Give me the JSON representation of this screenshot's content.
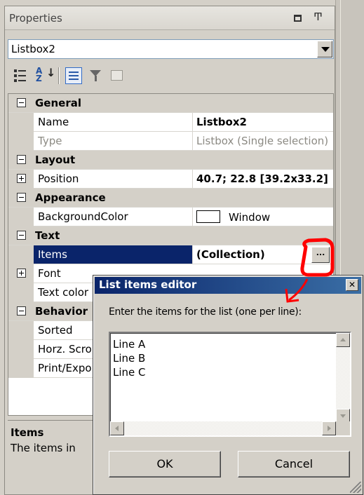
{
  "panel": {
    "title": "Properties",
    "maximize_icon": "maximize-icon",
    "pin_icon": "pin-icon"
  },
  "object_selector": {
    "value": "Listbox2"
  },
  "toolbar": {
    "az_top": "A",
    "az_bottom": "Z"
  },
  "grid": {
    "general": {
      "category": "General",
      "name_label": "Name",
      "name_value": "Listbox2",
      "type_label": "Type",
      "type_value": "Listbox (Single selection)"
    },
    "layout": {
      "category": "Layout",
      "position_label": "Position",
      "position_value": "40.7; 22.8 [39.2x33.2]"
    },
    "appearance": {
      "category": "Appearance",
      "bgcolor_label": "BackgroundColor",
      "bgcolor_value": "Window"
    },
    "text": {
      "category": "Text",
      "items_label": "Items",
      "items_value": "(Collection)",
      "ellipsis": "...",
      "font_label": "Font",
      "textcolor_label": "Text color"
    },
    "behavior": {
      "category": "Behavior",
      "sorted_label": "Sorted",
      "horz_label": "Horz. Scroll",
      "print_label": "Print/Export"
    }
  },
  "description": {
    "title": "Items",
    "text": "The items in"
  },
  "dialog": {
    "title": "List items editor",
    "close": "✕",
    "prompt": "Enter the items for the list (one per line):",
    "lines": [
      "Line A",
      "Line B",
      "Line C"
    ],
    "ok": "OK",
    "cancel": "Cancel"
  },
  "colors": {
    "selection": "#0a246a",
    "annotation": "#ff0000"
  }
}
